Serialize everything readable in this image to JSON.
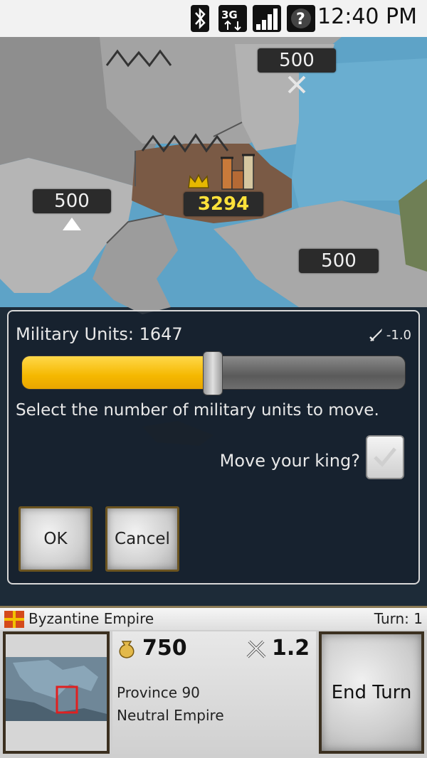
{
  "status_bar": {
    "time": "12:40 PM",
    "icons": [
      "bluetooth-icon",
      "3g-data-icon",
      "signal-strength-icon",
      "help-icon"
    ]
  },
  "map": {
    "provinces": [
      {
        "label": "500",
        "owner": "neutral"
      },
      {
        "label": "500",
        "owner": "neutral"
      },
      {
        "label": "3294",
        "owner": "player"
      },
      {
        "label": "500",
        "owner": "neutral"
      }
    ],
    "colors": {
      "sea": "#5ea3c7",
      "neutral_land": "#9a9a9a",
      "player_land": "#7a5a45",
      "label_bg": "#2b2b2b",
      "player_label": "#ffe23a"
    }
  },
  "dialog": {
    "units_label": "Military Units: 1647",
    "sword_modifier": "-1.0",
    "slider": {
      "fraction": 0.5
    },
    "instructions": "Select the number of military units to move.",
    "king_label": "Move your king?",
    "king_checked": false,
    "ok_label": "OK",
    "cancel_label": "Cancel"
  },
  "bottom_panel": {
    "empire_name": "Byzantine Empire",
    "turn_label": "Turn: 1",
    "gold": "750",
    "power": "1.2",
    "province_name": "Province 90",
    "province_owner": "Neutral Empire",
    "end_turn_label": "End Turn"
  }
}
